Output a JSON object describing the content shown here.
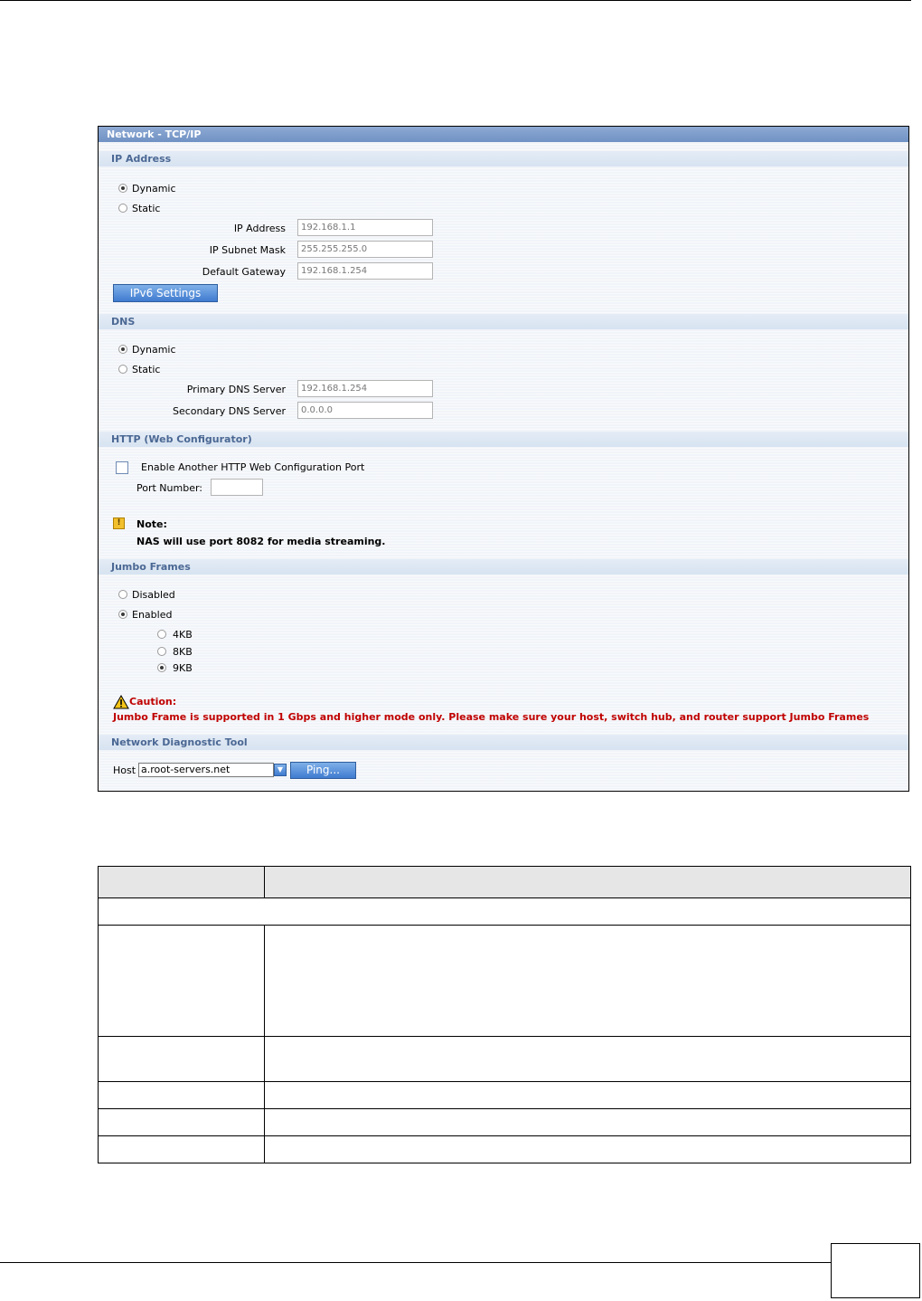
{
  "panel": {
    "title": "Network - TCP/IP",
    "ip_section": {
      "header": "IP Address",
      "dynamic_label": "Dynamic",
      "static_label": "Static",
      "selected": "Dynamic",
      "fields": [
        {
          "label": "IP Address",
          "value": "192.168.1.1"
        },
        {
          "label": "IP Subnet Mask",
          "value": "255.255.255.0"
        },
        {
          "label": "Default Gateway",
          "value": "192.168.1.254"
        }
      ],
      "ipv6_button": "IPv6 Settings"
    },
    "dns_section": {
      "header": "DNS",
      "dynamic_label": "Dynamic",
      "static_label": "Static",
      "selected": "Dynamic",
      "fields": [
        {
          "label": "Primary DNS Server",
          "value": "192.168.1.254"
        },
        {
          "label": "Secondary DNS Server",
          "value": "0.0.0.0"
        }
      ]
    },
    "http_section": {
      "header": "HTTP (Web Configurator)",
      "checkbox_label": "Enable Another HTTP Web Configuration Port",
      "checked": false,
      "port_label": "Port Number:",
      "port_value": "",
      "note_title": "Note:",
      "note_text": "NAS will use port 8082 for media streaming."
    },
    "jumbo_section": {
      "header": "Jumbo Frames",
      "disabled_label": "Disabled",
      "enabled_label": "Enabled",
      "selected": "Enabled",
      "sizes": [
        "4KB",
        "8KB",
        "9KB"
      ],
      "selected_size": "9KB",
      "caution_title": "Caution:",
      "caution_text": "Jumbo Frame is supported in 1 Gbps and higher mode only. Please make sure your host, switch hub, and router support Jumbo Frames",
      "caution_color": "#c00000"
    },
    "diag_section": {
      "header": "Network Diagnostic Tool",
      "host_label": "Host",
      "host_value": "a.root-servers.net",
      "ping_button": "Ping..."
    }
  },
  "colors": {
    "title_bar": "#7b9bcb",
    "section_text": "#4b6894",
    "button": "#4f8ad8"
  }
}
